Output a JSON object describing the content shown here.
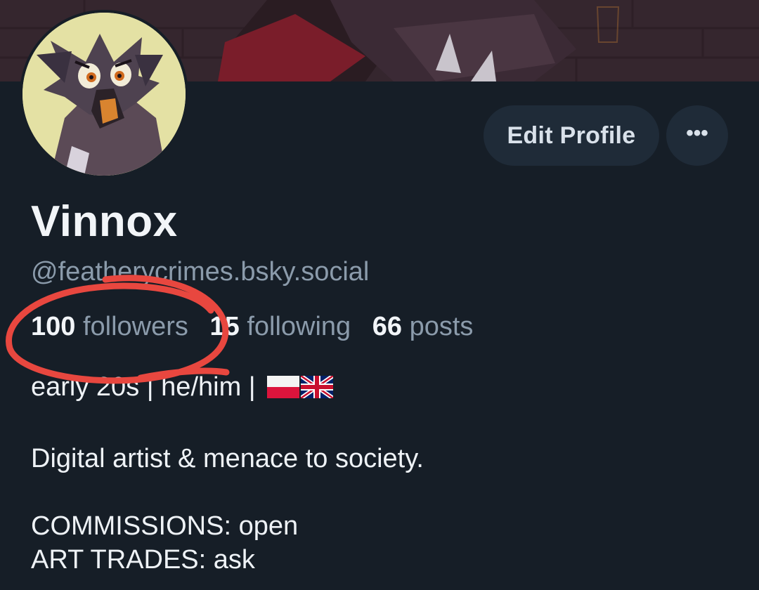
{
  "profile": {
    "display_name": "Vinnox",
    "handle": "@featherycrimes.bsky.social",
    "edit_button_label": "Edit Profile",
    "more_button_label": "•••"
  },
  "stats": {
    "followers_count": "100",
    "followers_label": "followers",
    "following_count": "15",
    "following_label": "following",
    "posts_count": "66",
    "posts_label": "posts"
  },
  "bio": {
    "line1": "early 20s | he/him |",
    "line2": "Digital artist & menace to society.",
    "line3": "COMMISSIONS: open",
    "line4": "ART TRADES: ask",
    "flags": [
      "poland-flag-icon",
      "uk-flag-icon"
    ]
  },
  "colors": {
    "background": "#161e27",
    "button_bg": "#1f2b38",
    "muted_text": "#8b9bab",
    "annotation_red": "#e8473f"
  }
}
